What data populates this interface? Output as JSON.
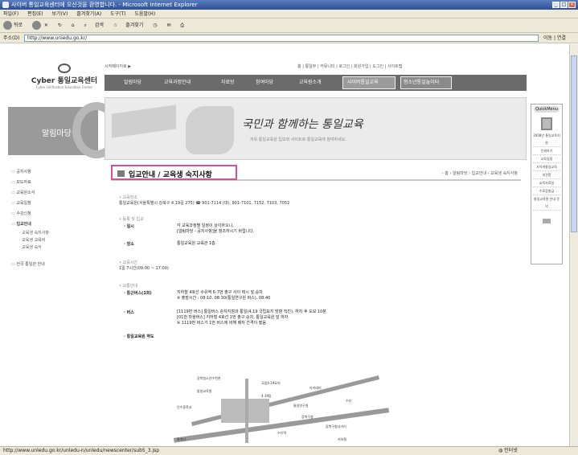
{
  "window": {
    "title": "사이버 통일교육센터에 오신것을 환영합니다. - Microsoft Internet Explorer",
    "min": "_",
    "max": "□",
    "close": "×"
  },
  "menu": [
    "파일(F)",
    "편집(E)",
    "보기(V)",
    "즐겨찾기(A)",
    "도구(T)",
    "도움말(H)"
  ],
  "toolbar": {
    "back": "뒤로",
    "search": "검색",
    "favorites": "즐겨찾기"
  },
  "address": {
    "label": "주소(D)",
    "url": "http://www.uniedu.go.kr/",
    "go": "이동",
    "links": "연결"
  },
  "status": {
    "url": "http://www.unledu.go.kr/unledu-n/unledu/newscenter/sub5_3.jsp",
    "zone": "인터넷"
  },
  "site": {
    "logo_name": "Cyber 통일교육센터",
    "logo_en": "Cyber Unification Education Center",
    "breadcrumb_top": "시작페이지로 ▶",
    "toplinks": "홈 | 통일부 | 커뮤니티 | 로그인 | 회원가입 | 도그인 | 사이트맵",
    "nav": [
      "알림마당",
      "교육과정안내",
      "자료방",
      "참여마당",
      "교육원소개",
      "사이버통일교육",
      "청소년통일놀이터"
    ],
    "banner_title": "국민과 함께하는 통일교육",
    "banner_sub": "자유·통일교육원 입보와 사이트로 통일교육에 참여하세요.",
    "left_title": "알림마당"
  },
  "side": {
    "items": [
      "공지사항",
      "보도자료",
      "교육원소식",
      "교육일정",
      "수강신청",
      "입교안내"
    ],
    "subs": [
      "교육생 숙지사항",
      "교육생 교육비",
      "교육생 숙식"
    ],
    "extra": "전국 통일관 안내"
  },
  "quick": {
    "head": "QuickMenu",
    "items": [
      "2008년 통일교육지원",
      "인쇄하기",
      "교육일정",
      "사이버통일교육",
      "의견함",
      "교육자료실",
      "수료증발급",
      "통일교육원 안내 문의"
    ]
  },
  "page": {
    "title": "입교안내 / 교육생 숙지사항",
    "breadcrumb": "› 홈 › 알림마당 › 입교안내 › 교육생 숙지사항"
  },
  "content": {
    "place_label": "교육장소",
    "place_text": "통일교육원(서울특별시 강북구 4.19길 275) ☎ 901-7114 (대), 901-7101, 7152, 7103, 7052",
    "reg_label": "등록 및 입교",
    "time_k": "· 일시",
    "time_v1": "각 교육과정별 일정이 상이하오니,",
    "time_v2": "[알림마당 - 공지사항]을 참조하시기 바랍니다.",
    "loc_k": "· 장소",
    "loc_v": "통일교육원 교육관 1층",
    "hours_label": "교육시간",
    "hours_text": "1일 7시간(09:00 ~ 17:00)",
    "traffic_label": "교통안내",
    "bus1_k": "· 통근버스(1회)",
    "bus1_v1": "지하철 4호선 수유역 6-7번 출구 사이 택시 앞 승차",
    "bus1_v2": "※ 출발시간 : 08:10, 08:30(통일연구원 버스), 08:40",
    "bus2_k": "· 버스",
    "bus2_v1": "[1119번 버스] 통일버스 순차지점과 통일(4.19 국립묘지 방향 직진), 하차 후 도보 10분",
    "bus2_v2": "[01번 마을버스] 지하철 4호선 1번 출구 승차, 통일교육원 앞 하차",
    "bus2_v3": "※ 1119번 버스가 1번 버스에 비해 배차 간격이 짧음",
    "map_label": "· 통일교육원 약도"
  },
  "map": [
    "강북청소년수련관",
    "국립4·19묘지",
    "통일교육원",
    "아카데미",
    "4·19탑",
    "통일연구원",
    "인수중학교",
    "화계사",
    "수유",
    "강북구청",
    "강북구청사거리",
    "수유역",
    "지하철"
  ]
}
